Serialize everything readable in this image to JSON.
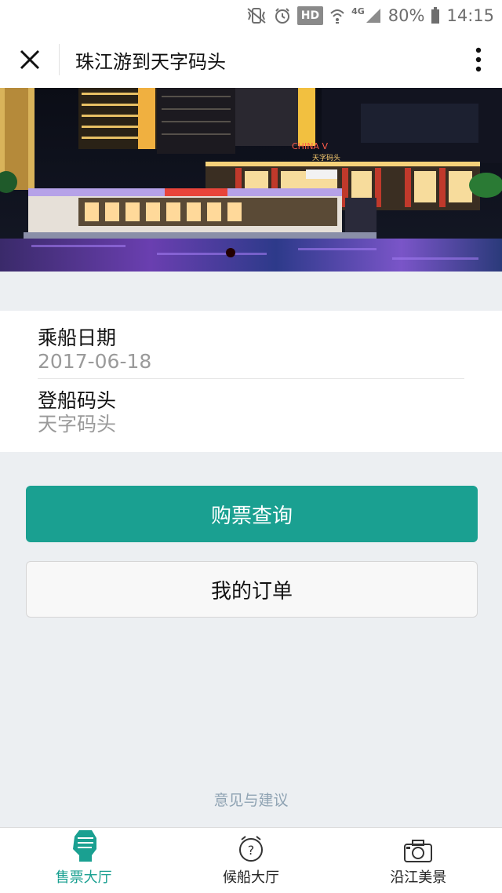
{
  "status_bar": {
    "icons": [
      "mute-vibrate-icon",
      "alarm-icon",
      "hd-icon",
      "wifi-icon",
      "signal-icon",
      "battery-icon"
    ],
    "hd_label": "HD",
    "network_label": "4G",
    "battery": "80%",
    "time": "14:15"
  },
  "title_bar": {
    "title": "珠江游到天字码头",
    "close_icon": "close-icon",
    "more_icon": "more-vertical-icon"
  },
  "banner": {
    "sign_text": "天字码头",
    "sign_text_small": "CHINA V"
  },
  "form": {
    "date_label": "乘船日期",
    "date_value": "2017-06-18",
    "pier_label": "登船码头",
    "pier_value": "天字码头"
  },
  "buttons": {
    "query": "购票查询",
    "my_orders": "我的订单"
  },
  "feedback_link": "意见与建议",
  "tabs": [
    {
      "label": "售票大厅",
      "icon": "fist-icon",
      "active": true
    },
    {
      "label": "候船大厅",
      "icon": "alarm-clock-question-icon",
      "active": false
    },
    {
      "label": "沿江美景",
      "icon": "camera-icon",
      "active": false
    }
  ],
  "colors": {
    "accent": "#1aa091",
    "background": "#eceff2"
  }
}
